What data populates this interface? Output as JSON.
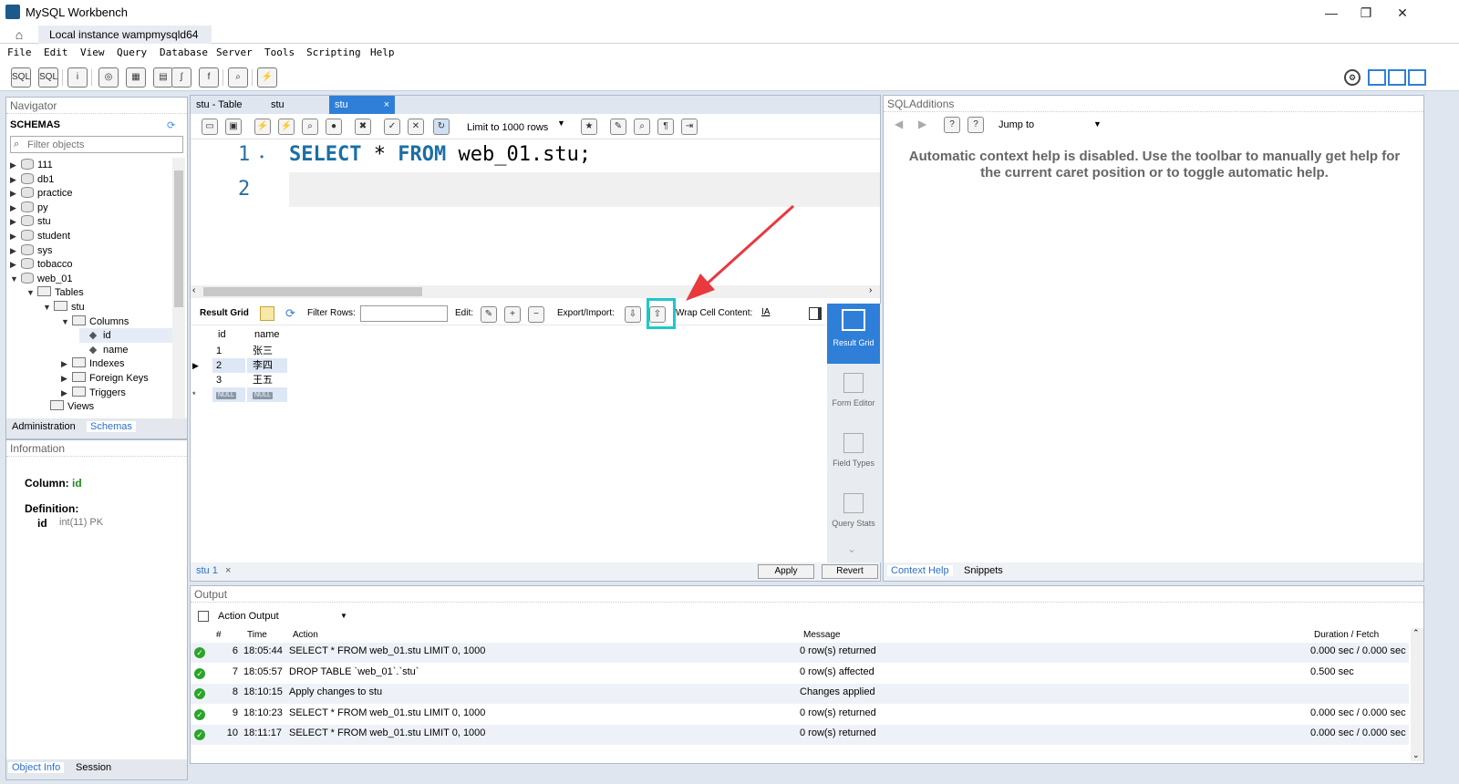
{
  "window": {
    "title": "MySQL Workbench",
    "minimize": "—",
    "restore": "❐",
    "close": "✕"
  },
  "connection_tab": {
    "label": "Local instance wampmysqld64",
    "close": "×"
  },
  "menu": [
    "File",
    "Edit",
    "View",
    "Query",
    "Database",
    "Server",
    "Tools",
    "Scripting",
    "Help"
  ],
  "navigator": {
    "header": "Navigator",
    "schemas_label": "SCHEMAS",
    "filter_placeholder": "Filter objects",
    "tree": [
      {
        "label": "111",
        "arrow": "▶",
        "icon": "db"
      },
      {
        "label": "db1",
        "arrow": "▶",
        "icon": "db"
      },
      {
        "label": "practice",
        "arrow": "▶",
        "icon": "db"
      },
      {
        "label": "py",
        "arrow": "▶",
        "icon": "db"
      },
      {
        "label": "stu",
        "arrow": "▶",
        "icon": "db"
      },
      {
        "label": "student",
        "arrow": "▶",
        "icon": "db"
      },
      {
        "label": "sys",
        "arrow": "▶",
        "icon": "db"
      },
      {
        "label": "tobacco",
        "arrow": "▶",
        "icon": "db"
      },
      {
        "label": "web_01",
        "arrow": "▼",
        "icon": "db"
      },
      {
        "label": "Tables",
        "arrow": "▼",
        "icon": "folder"
      },
      {
        "label": "stu",
        "arrow": "▼",
        "icon": "table"
      },
      {
        "label": "Columns",
        "arrow": "▼",
        "icon": "folder"
      },
      {
        "label": "id",
        "arrow": "",
        "icon": "column"
      },
      {
        "label": "name",
        "arrow": "",
        "icon": "column"
      },
      {
        "label": "Indexes",
        "arrow": "▶",
        "icon": "folder"
      },
      {
        "label": "Foreign Keys",
        "arrow": "▶",
        "icon": "folder"
      },
      {
        "label": "Triggers",
        "arrow": "▶",
        "icon": "folder"
      },
      {
        "label": "Views",
        "arrow": "",
        "icon": "folder"
      }
    ],
    "tabs": [
      "Administration",
      "Schemas"
    ]
  },
  "information": {
    "header": "Information",
    "column_label": "Column:",
    "column_value": "id",
    "definition_label": "Definition:",
    "def_name": "id",
    "def_type": "int(11) PK",
    "tabs": [
      "Object Info",
      "Session"
    ]
  },
  "editor": {
    "tabs": [
      "stu - Table",
      "stu",
      "stu"
    ],
    "tab_close": "×",
    "limit": "Limit to 1000 rows",
    "line1_no": "1",
    "line2_no": "2",
    "sql": {
      "kw1": "SELECT",
      "star": " * ",
      "kw2": "FROM",
      "rest": " web_01.stu;"
    }
  },
  "result_toolbar": {
    "result_grid": "Result Grid",
    "filter_rows": "Filter Rows:",
    "edit": "Edit:",
    "export_import": "Export/Import:",
    "wrap": "Wrap Cell Content:"
  },
  "grid": {
    "columns": [
      "id",
      "name"
    ],
    "rows": [
      [
        "1",
        "张三"
      ],
      [
        "2",
        "李四"
      ],
      [
        "3",
        "王五"
      ]
    ],
    "null": "NULL",
    "new_row_marker": "*",
    "current_marker": "▶"
  },
  "side_strip": [
    "Result Grid",
    "Form Editor",
    "Field Types",
    "Query Stats"
  ],
  "result_tab": "stu 1",
  "buttons": {
    "apply": "Apply",
    "revert": "Revert"
  },
  "sql_additions": {
    "header": "SQLAdditions",
    "jump_to": "Jump to",
    "help_text": "Automatic context help is disabled. Use the toolbar to manually get help for the current caret position or to toggle automatic help.",
    "tabs": [
      "Context Help",
      "Snippets"
    ]
  },
  "output": {
    "header": "Output",
    "mode": "Action Output",
    "columns": [
      "#",
      "Time",
      "Action",
      "Message",
      "Duration / Fetch"
    ],
    "rows": [
      {
        "n": "6",
        "time": "18:05:44",
        "action": "SELECT * FROM web_01.stu LIMIT 0, 1000",
        "message": "0 row(s) returned",
        "duration": "0.000 sec / 0.000 sec"
      },
      {
        "n": "7",
        "time": "18:05:57",
        "action": "DROP TABLE `web_01`.`stu`",
        "message": "0 row(s) affected",
        "duration": "0.500 sec"
      },
      {
        "n": "8",
        "time": "18:10:15",
        "action": "Apply changes to stu",
        "message": "Changes applied",
        "duration": ""
      },
      {
        "n": "9",
        "time": "18:10:23",
        "action": "SELECT * FROM web_01.stu LIMIT 0, 1000",
        "message": "0 row(s) returned",
        "duration": "0.000 sec / 0.000 sec"
      },
      {
        "n": "10",
        "time": "18:11:17",
        "action": "SELECT * FROM web_01.stu LIMIT 0, 1000",
        "message": "0 row(s) returned",
        "duration": "0.000 sec / 0.000 sec"
      }
    ]
  },
  "colors": {
    "accent": "#2f7fd8",
    "highlight": "#1ec7c9",
    "arrow": "#e8393f",
    "ok": "#2aa52a"
  }
}
